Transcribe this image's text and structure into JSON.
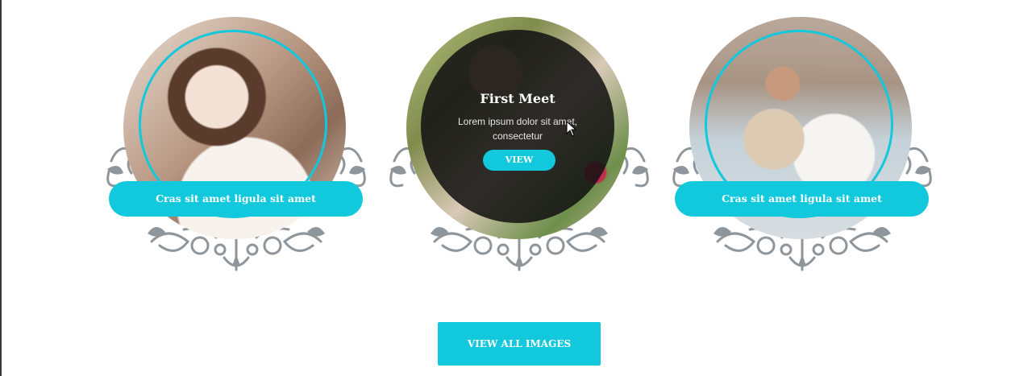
{
  "gallery": {
    "items": [
      {
        "caption": "Cras sit amet ligula sit amet",
        "image": "bride-portrait-photo"
      },
      {
        "image": "couple-first-meet-photo",
        "overlay": {
          "title": "First Meet",
          "text": "Lorem ipsum dolor sit amet, consectetur",
          "button_label": "VIEW"
        }
      },
      {
        "caption": "Cras sit amet ligula sit amet",
        "image": "couple-seaside-photo"
      }
    ]
  },
  "view_all_label": "VIEW ALL IMAGES",
  "colors": {
    "accent": "#12c8dd",
    "flourish": "#8e969c",
    "overlay": "#121212"
  },
  "icons": {
    "cursor": "mouse-pointer-icon",
    "ornament": "floral-ornament"
  }
}
